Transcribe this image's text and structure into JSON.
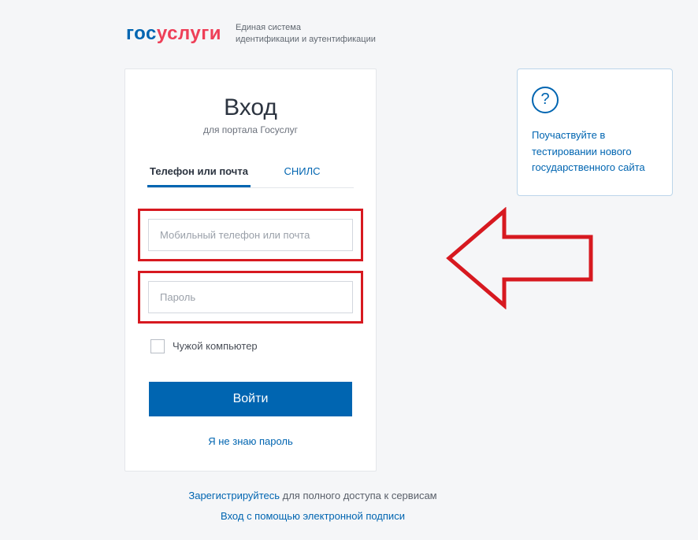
{
  "header": {
    "logo_part1": "гос",
    "logo_part2": "услуги",
    "tagline_line1": "Единая система",
    "tagline_line2": "идентификации и аутентификации"
  },
  "login": {
    "title": "Вход",
    "subtitle": "для портала Госуслуг",
    "tabs": {
      "phone_email": "Телефон или почта",
      "snils": "СНИЛС"
    },
    "login_placeholder": "Мобильный телефон или почта",
    "password_placeholder": "Пароль",
    "foreign_computer_label": "Чужой компьютер",
    "submit_label": "Войти",
    "forgot_label": "Я не знаю пароль"
  },
  "info_panel": {
    "icon_char": "?",
    "text": "Поучаствуйте в тестировании нового государственного сайта"
  },
  "footer": {
    "register_link": "Зарегистрируйтесь",
    "register_suffix": " для полного доступа к сервисам",
    "esignature_link": "Вход с помощью электронной подписи"
  },
  "colors": {
    "brand_blue": "#0065b1",
    "brand_red": "#ee3f58",
    "highlight_red": "#d71920"
  }
}
